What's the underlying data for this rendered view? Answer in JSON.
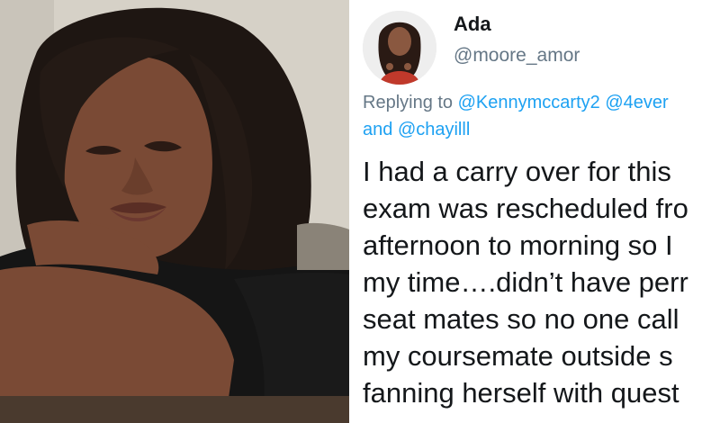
{
  "tweet": {
    "author_name": "Ada",
    "author_handle": "@moore_amor",
    "reply_prefix": "Replying to ",
    "reply_mention_1": "@Kennymccarty2",
    "reply_mention_2": "@4ever",
    "reply_and": "and ",
    "reply_mention_3": "@chayilll",
    "body_lines": [
      "I had a carry over for this",
      "exam was rescheduled fro",
      "afternoon to morning so I",
      "my time….didn’t have perr",
      "seat mates so no one call",
      "my coursemate outside s",
      "fanning herself with quest"
    ]
  },
  "photo": {
    "subject": "woman resting chin on folded arms",
    "colors": {
      "background": "#d6d1c7",
      "skin": "#7a4a35",
      "hair": "#1e1612",
      "sleeve": "#151515"
    }
  },
  "colors": {
    "text_primary": "#14171a",
    "text_secondary": "#657786",
    "mention": "#1da1f2"
  }
}
